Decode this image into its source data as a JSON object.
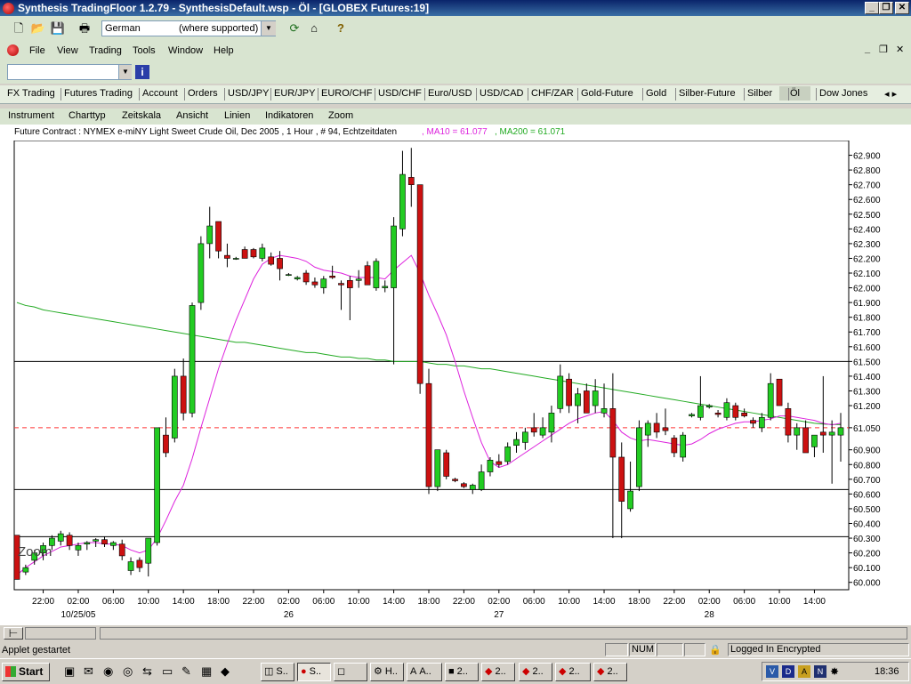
{
  "window": {
    "title": "Synthesis TradingFloor 1.2.79 - SynthesisDefault.wsp - Öl - [GLOBEX Futures:19]",
    "minimize": "_",
    "restore": "❐",
    "close": "✕"
  },
  "toolbar": {
    "language": "German",
    "language_hint": "(where supported)"
  },
  "menubar": {
    "items": [
      "File",
      "View",
      "Trading",
      "Tools",
      "Window",
      "Help"
    ]
  },
  "tabs": [
    "FX Trading",
    "Futures Trading",
    "Account",
    "Orders",
    "USD/JPY",
    "EUR/JPY",
    "EURO/CHF",
    "USD/CHF",
    "Euro/USD",
    "USD/CAD",
    "CHF/ZAR",
    "Gold-Future",
    "Gold",
    "Silber-Future",
    "Silber",
    "Öl",
    "Dow Jones"
  ],
  "active_tab": "Öl",
  "chart_menu": [
    "Instrument",
    "Charttyp",
    "Zeitskala",
    "Ansicht",
    "Linien",
    "Indikatoren",
    "Zoom"
  ],
  "chart_info": {
    "contract": "Future Contract : NYMEX e-miNY Light Sweet Crude Oil, Dec 2005 , 1 Hour , # 94, Echtzeitdaten",
    "ma10": ", MA10 = 61.077",
    "ma200": ", MA200 = 61.071"
  },
  "chart_data": {
    "type": "candlestick",
    "ylim": [
      59.95,
      63.0
    ],
    "y_ticks": [
      "62.900",
      "62.800",
      "62.700",
      "62.600",
      "62.500",
      "62.400",
      "62.300",
      "62.200",
      "62.100",
      "62.000",
      "61.900",
      "61.800",
      "61.700",
      "61.600",
      "61.500",
      "61.400",
      "61.300",
      "61.200",
      "61.050",
      "60.900",
      "60.800",
      "60.700",
      "60.600",
      "60.500",
      "60.400",
      "60.300",
      "60.200",
      "60.100",
      "60.000"
    ],
    "y_tick_values": [
      62.9,
      62.8,
      62.7,
      62.6,
      62.5,
      62.4,
      62.3,
      62.2,
      62.1,
      62.0,
      61.9,
      61.8,
      61.7,
      61.6,
      61.5,
      61.4,
      61.3,
      61.2,
      61.05,
      60.9,
      60.8,
      60.7,
      60.6,
      60.5,
      60.4,
      60.3,
      60.2,
      60.1,
      60.0
    ],
    "x_ticks": [
      "22:00",
      "02:00",
      "06:00",
      "10:00",
      "14:00",
      "18:00",
      "22:00",
      "02:00",
      "06:00",
      "10:00",
      "14:00",
      "18:00",
      "22:00",
      "02:00",
      "06:00",
      "10:00",
      "14:00",
      "18:00",
      "22:00",
      "02:00",
      "06:00",
      "10:00",
      "14:00"
    ],
    "x_tick_index": [
      3,
      7,
      11,
      15,
      19,
      23,
      27,
      31,
      35,
      39,
      43,
      47,
      51,
      55,
      59,
      63,
      67,
      71,
      75,
      79,
      83,
      87,
      91
    ],
    "date_labels": [
      {
        "text": "10/25/05",
        "index": 7
      },
      {
        "text": "26",
        "index": 31
      },
      {
        "text": "27",
        "index": 55
      },
      {
        "text": "28",
        "index": 79
      }
    ],
    "horizontal_lines": [
      61.5,
      60.63,
      60.31
    ],
    "current_price_line": 61.05,
    "zoom_label": "Zoom",
    "candles": [
      {
        "o": 60.32,
        "h": 60.32,
        "l": 60.02,
        "c": 60.02
      },
      {
        "o": 60.07,
        "h": 60.12,
        "l": 60.05,
        "c": 60.1
      },
      {
        "o": 60.15,
        "h": 60.22,
        "l": 60.12,
        "c": 60.2
      },
      {
        "o": 60.2,
        "h": 60.27,
        "l": 60.15,
        "c": 60.25
      },
      {
        "o": 60.25,
        "h": 60.32,
        "l": 60.22,
        "c": 60.3
      },
      {
        "o": 60.28,
        "h": 60.35,
        "l": 60.25,
        "c": 60.33
      },
      {
        "o": 60.32,
        "h": 60.34,
        "l": 60.22,
        "c": 60.25
      },
      {
        "o": 60.22,
        "h": 60.27,
        "l": 60.18,
        "c": 60.25
      },
      {
        "o": 60.26,
        "h": 60.28,
        "l": 60.22,
        "c": 60.27
      },
      {
        "o": 60.28,
        "h": 60.3,
        "l": 60.24,
        "c": 60.29
      },
      {
        "o": 60.29,
        "h": 60.31,
        "l": 60.24,
        "c": 60.26
      },
      {
        "o": 60.25,
        "h": 60.28,
        "l": 60.22,
        "c": 60.27
      },
      {
        "o": 60.26,
        "h": 60.29,
        "l": 60.15,
        "c": 60.18
      },
      {
        "o": 60.08,
        "h": 60.17,
        "l": 60.05,
        "c": 60.14
      },
      {
        "o": 60.15,
        "h": 60.17,
        "l": 60.07,
        "c": 60.1
      },
      {
        "o": 60.13,
        "h": 60.3,
        "l": 60.04,
        "c": 60.3
      },
      {
        "o": 60.27,
        "h": 61.05,
        "l": 60.25,
        "c": 61.05
      },
      {
        "o": 61.0,
        "h": 61.12,
        "l": 60.85,
        "c": 60.88
      },
      {
        "o": 60.98,
        "h": 61.45,
        "l": 60.95,
        "c": 61.4
      },
      {
        "o": 61.4,
        "h": 61.52,
        "l": 61.1,
        "c": 61.15
      },
      {
        "o": 61.15,
        "h": 61.9,
        "l": 61.12,
        "c": 61.88
      },
      {
        "o": 61.9,
        "h": 62.35,
        "l": 61.85,
        "c": 62.3
      },
      {
        "o": 62.3,
        "h": 62.55,
        "l": 62.2,
        "c": 62.42
      },
      {
        "o": 62.45,
        "h": 62.45,
        "l": 62.2,
        "c": 62.25
      },
      {
        "o": 62.22,
        "h": 62.3,
        "l": 62.14,
        "c": 62.2
      },
      {
        "o": 62.2,
        "h": 62.21,
        "l": 62.19,
        "c": 62.2
      },
      {
        "o": 62.26,
        "h": 62.28,
        "l": 62.2,
        "c": 62.2
      },
      {
        "o": 62.26,
        "h": 62.27,
        "l": 62.2,
        "c": 62.21
      },
      {
        "o": 62.2,
        "h": 62.3,
        "l": 62.18,
        "c": 62.27
      },
      {
        "o": 62.21,
        "h": 62.24,
        "l": 62.15,
        "c": 62.16
      },
      {
        "o": 62.2,
        "h": 62.25,
        "l": 62.05,
        "c": 62.13
      },
      {
        "o": 62.09,
        "h": 62.1,
        "l": 62.08,
        "c": 62.09
      },
      {
        "o": 62.06,
        "h": 62.08,
        "l": 62.05,
        "c": 62.07
      },
      {
        "o": 62.1,
        "h": 62.12,
        "l": 62.02,
        "c": 62.04
      },
      {
        "o": 62.04,
        "h": 62.07,
        "l": 62.0,
        "c": 62.02
      },
      {
        "o": 62.0,
        "h": 62.08,
        "l": 61.96,
        "c": 62.06
      },
      {
        "o": 62.08,
        "h": 62.15,
        "l": 62.06,
        "c": 62.07
      },
      {
        "o": 62.03,
        "h": 62.05,
        "l": 61.85,
        "c": 62.02
      },
      {
        "o": 62.05,
        "h": 62.08,
        "l": 61.78,
        "c": 62.0
      },
      {
        "o": 62.05,
        "h": 62.12,
        "l": 62.0,
        "c": 62.06
      },
      {
        "o": 62.15,
        "h": 62.18,
        "l": 62.02,
        "c": 62.02
      },
      {
        "o": 62.0,
        "h": 62.2,
        "l": 61.98,
        "c": 62.18
      },
      {
        "o": 62.0,
        "h": 62.05,
        "l": 61.97,
        "c": 62.01
      },
      {
        "o": 62.0,
        "h": 62.48,
        "l": 61.48,
        "c": 62.42
      },
      {
        "o": 62.4,
        "h": 62.93,
        "l": 62.35,
        "c": 62.77
      },
      {
        "o": 62.75,
        "h": 62.95,
        "l": 62.55,
        "c": 62.7
      },
      {
        "o": 62.7,
        "h": 62.7,
        "l": 61.28,
        "c": 61.35
      },
      {
        "o": 61.35,
        "h": 61.45,
        "l": 60.6,
        "c": 60.65
      },
      {
        "o": 60.65,
        "h": 60.9,
        "l": 60.62,
        "c": 60.9
      },
      {
        "o": 60.88,
        "h": 60.9,
        "l": 60.7,
        "c": 60.72
      },
      {
        "o": 60.7,
        "h": 60.71,
        "l": 60.68,
        "c": 60.69
      },
      {
        "o": 60.67,
        "h": 60.68,
        "l": 60.64,
        "c": 60.65
      },
      {
        "o": 60.63,
        "h": 60.67,
        "l": 60.6,
        "c": 60.66
      },
      {
        "o": 60.63,
        "h": 60.8,
        "l": 60.62,
        "c": 60.75
      },
      {
        "o": 60.75,
        "h": 60.85,
        "l": 60.72,
        "c": 60.83
      },
      {
        "o": 60.82,
        "h": 60.87,
        "l": 60.78,
        "c": 60.8
      },
      {
        "o": 60.82,
        "h": 60.95,
        "l": 60.8,
        "c": 60.92
      },
      {
        "o": 60.93,
        "h": 61.02,
        "l": 60.88,
        "c": 60.97
      },
      {
        "o": 60.95,
        "h": 61.05,
        "l": 60.9,
        "c": 61.02
      },
      {
        "o": 61.05,
        "h": 61.15,
        "l": 60.99,
        "c": 61.02
      },
      {
        "o": 61.0,
        "h": 61.12,
        "l": 60.98,
        "c": 61.05
      },
      {
        "o": 61.02,
        "h": 61.2,
        "l": 60.95,
        "c": 61.15
      },
      {
        "o": 61.18,
        "h": 61.48,
        "l": 61.15,
        "c": 61.4
      },
      {
        "o": 61.38,
        "h": 61.42,
        "l": 61.15,
        "c": 61.2
      },
      {
        "o": 61.2,
        "h": 61.32,
        "l": 61.08,
        "c": 61.28
      },
      {
        "o": 61.3,
        "h": 61.35,
        "l": 61.15,
        "c": 61.15
      },
      {
        "o": 61.2,
        "h": 61.38,
        "l": 61.15,
        "c": 61.3
      },
      {
        "o": 61.15,
        "h": 61.35,
        "l": 61.12,
        "c": 61.18
      },
      {
        "o": 61.18,
        "h": 61.42,
        "l": 60.3,
        "c": 60.85
      },
      {
        "o": 60.85,
        "h": 60.95,
        "l": 60.3,
        "c": 60.55
      },
      {
        "o": 60.5,
        "h": 60.82,
        "l": 60.48,
        "c": 60.62
      },
      {
        "o": 60.65,
        "h": 61.1,
        "l": 60.62,
        "c": 61.05
      },
      {
        "o": 61.0,
        "h": 61.1,
        "l": 60.92,
        "c": 61.08
      },
      {
        "o": 61.08,
        "h": 61.15,
        "l": 60.98,
        "c": 61.02
      },
      {
        "o": 61.05,
        "h": 61.18,
        "l": 61.0,
        "c": 61.03
      },
      {
        "o": 60.98,
        "h": 61.0,
        "l": 60.85,
        "c": 60.88
      },
      {
        "o": 60.85,
        "h": 61.02,
        "l": 60.82,
        "c": 61.0
      },
      {
        "o": 61.13,
        "h": 61.15,
        "l": 61.12,
        "c": 61.14
      },
      {
        "o": 61.12,
        "h": 61.4,
        "l": 61.1,
        "c": 61.2
      },
      {
        "o": 61.19,
        "h": 61.21,
        "l": 61.18,
        "c": 61.2
      },
      {
        "o": 61.15,
        "h": 61.17,
        "l": 61.12,
        "c": 61.14
      },
      {
        "o": 61.12,
        "h": 61.25,
        "l": 61.1,
        "c": 61.22
      },
      {
        "o": 61.2,
        "h": 61.22,
        "l": 61.1,
        "c": 61.12
      },
      {
        "o": 61.15,
        "h": 61.18,
        "l": 61.12,
        "c": 61.13
      },
      {
        "o": 61.1,
        "h": 61.12,
        "l": 61.05,
        "c": 61.08
      },
      {
        "o": 61.05,
        "h": 61.15,
        "l": 61.02,
        "c": 61.12
      },
      {
        "o": 61.12,
        "h": 61.42,
        "l": 61.1,
        "c": 61.35
      },
      {
        "o": 61.38,
        "h": 61.38,
        "l": 61.2,
        "c": 61.2
      },
      {
        "o": 61.18,
        "h": 61.22,
        "l": 60.95,
        "c": 61.0
      },
      {
        "o": 61.0,
        "h": 61.08,
        "l": 60.9,
        "c": 61.05
      },
      {
        "o": 61.05,
        "h": 61.1,
        "l": 60.88,
        "c": 60.88
      },
      {
        "o": 60.92,
        "h": 61.0,
        "l": 60.85,
        "c": 61.0
      },
      {
        "o": 61.02,
        "h": 61.4,
        "l": 60.88,
        "c": 61.0
      },
      {
        "o": 61.0,
        "h": 61.1,
        "l": 60.67,
        "c": 61.02
      },
      {
        "o": 61.0,
        "h": 61.15,
        "l": 60.82,
        "c": 61.05
      }
    ],
    "ma10": [
      60.05,
      60.1,
      60.14,
      60.18,
      60.21,
      60.24,
      60.25,
      60.26,
      60.27,
      60.27,
      60.26,
      60.26,
      60.25,
      60.22,
      60.2,
      60.22,
      60.3,
      60.42,
      60.55,
      60.66,
      60.84,
      61.05,
      61.25,
      61.45,
      61.62,
      61.78,
      61.92,
      62.06,
      62.16,
      62.2,
      62.22,
      62.21,
      62.2,
      62.18,
      62.14,
      62.12,
      62.11,
      62.1,
      62.08,
      62.07,
      62.07,
      62.07,
      62.06,
      62.12,
      62.17,
      62.22,
      62.1,
      61.95,
      61.82,
      61.68,
      61.5,
      61.3,
      61.12,
      60.95,
      60.82,
      60.78,
      60.8,
      60.84,
      60.88,
      60.92,
      60.96,
      61.0,
      61.04,
      61.08,
      61.11,
      61.13,
      61.15,
      61.16,
      61.1,
      61.02,
      60.98,
      60.96,
      60.97,
      60.96,
      60.95,
      60.94,
      60.93,
      60.94,
      60.97,
      61.01,
      61.04,
      61.06,
      61.08,
      61.09,
      61.09,
      61.1,
      61.11,
      61.13,
      61.13,
      61.12,
      61.11,
      61.1,
      61.08,
      61.07,
      61.08
    ],
    "ma200": [
      61.9,
      61.88,
      61.87,
      61.85,
      61.84,
      61.83,
      61.82,
      61.81,
      61.8,
      61.79,
      61.78,
      61.77,
      61.76,
      61.75,
      61.74,
      61.73,
      61.72,
      61.71,
      61.7,
      61.69,
      61.68,
      61.67,
      61.66,
      61.65,
      61.64,
      61.63,
      61.63,
      61.62,
      61.61,
      61.6,
      61.59,
      61.58,
      61.57,
      61.56,
      61.56,
      61.55,
      61.54,
      61.53,
      61.53,
      61.52,
      61.52,
      61.51,
      61.51,
      61.5,
      61.5,
      61.5,
      61.5,
      61.49,
      61.48,
      61.48,
      61.47,
      61.47,
      61.46,
      61.45,
      61.45,
      61.44,
      61.43,
      61.42,
      61.41,
      61.4,
      61.39,
      61.38,
      61.37,
      61.36,
      61.35,
      61.34,
      61.33,
      61.32,
      61.31,
      61.3,
      61.29,
      61.28,
      61.27,
      61.26,
      61.25,
      61.24,
      61.23,
      61.22,
      61.21,
      61.2,
      61.19,
      61.18,
      61.17,
      61.16,
      61.15,
      61.14,
      61.13,
      61.12,
      61.11,
      61.1,
      61.09,
      61.08,
      61.075,
      61.072,
      61.071
    ],
    "colors": {
      "up": "#22cc22",
      "down": "#cc1111",
      "ma10": "#dd22dd",
      "ma200": "#22aa22",
      "price_line": "#ff3333"
    }
  },
  "status": {
    "message": "Applet gestartet",
    "num": "NUM",
    "login": "Logged In Encrypted"
  },
  "taskbar": {
    "start": "Start",
    "tasks": [
      "S..",
      "S..",
      "",
      "H..",
      "A..",
      "2..",
      "2..",
      "2..",
      "2..",
      "2.."
    ],
    "clock": "18:36"
  }
}
